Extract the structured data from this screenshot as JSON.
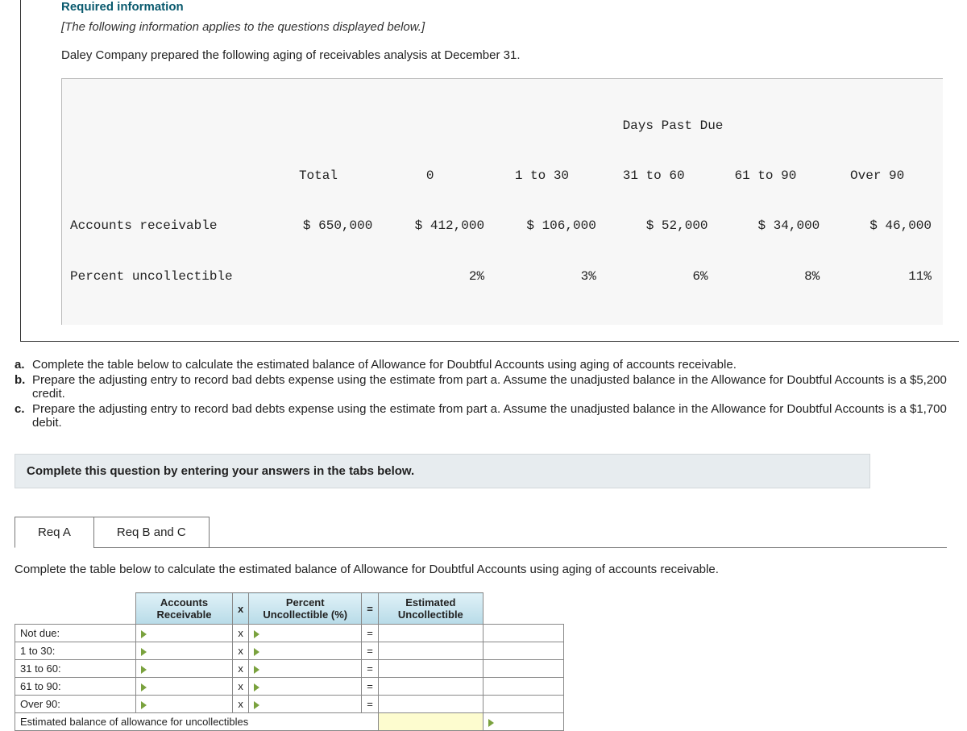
{
  "header": {
    "required": "Required information",
    "note": "[The following information applies to the questions displayed below.]",
    "intro": "Daley Company prepared the following aging of receivables analysis at December 31."
  },
  "aging": {
    "days_header": "Days Past Due",
    "col_headers": [
      "Total",
      "0",
      "1 to 30",
      "31 to 60",
      "61 to 90",
      "Over 90"
    ],
    "rows": [
      {
        "label": "Accounts receivable",
        "values": [
          "$ 650,000",
          "$ 412,000",
          "$ 106,000",
          "$ 52,000",
          "$ 34,000",
          "$ 46,000"
        ]
      },
      {
        "label": "Percent uncollectible",
        "values": [
          "",
          "2%",
          "3%",
          "6%",
          "8%",
          "11%"
        ]
      }
    ]
  },
  "questions": {
    "a": "Complete the table below to calculate the estimated balance of Allowance for Doubtful Accounts using aging of accounts receivable.",
    "b": "Prepare the adjusting entry to record bad debts expense using the estimate from part a. Assume the unadjusted balance in the Allowance for Doubtful Accounts is a $5,200 credit.",
    "c": "Prepare the adjusting entry to record bad debts expense using the estimate from part a. Assume the unadjusted balance in the Allowance for Doubtful Accounts is a $1,700 debit."
  },
  "complete_bar": "Complete this question by entering your answers in the tabs below.",
  "tabs": {
    "a": "Req A",
    "bc": "Req B and C"
  },
  "tab_a": {
    "desc": "Complete the table below to calculate the estimated balance of Allowance for Doubtful Accounts using aging of accounts receivable.",
    "headers": {
      "ar": "Accounts Receivable",
      "x": "x",
      "pct": "Percent Uncollectible (%)",
      "eq": "=",
      "est": "Estimated Uncollectible"
    },
    "rows": [
      "Not due:",
      "1 to 30:",
      "31 to 60:",
      "61 to 90:",
      "Over 90:"
    ],
    "symbols": {
      "x": "x",
      "eq": "="
    },
    "footer": "Estimated balance of allowance for uncollectibles"
  }
}
